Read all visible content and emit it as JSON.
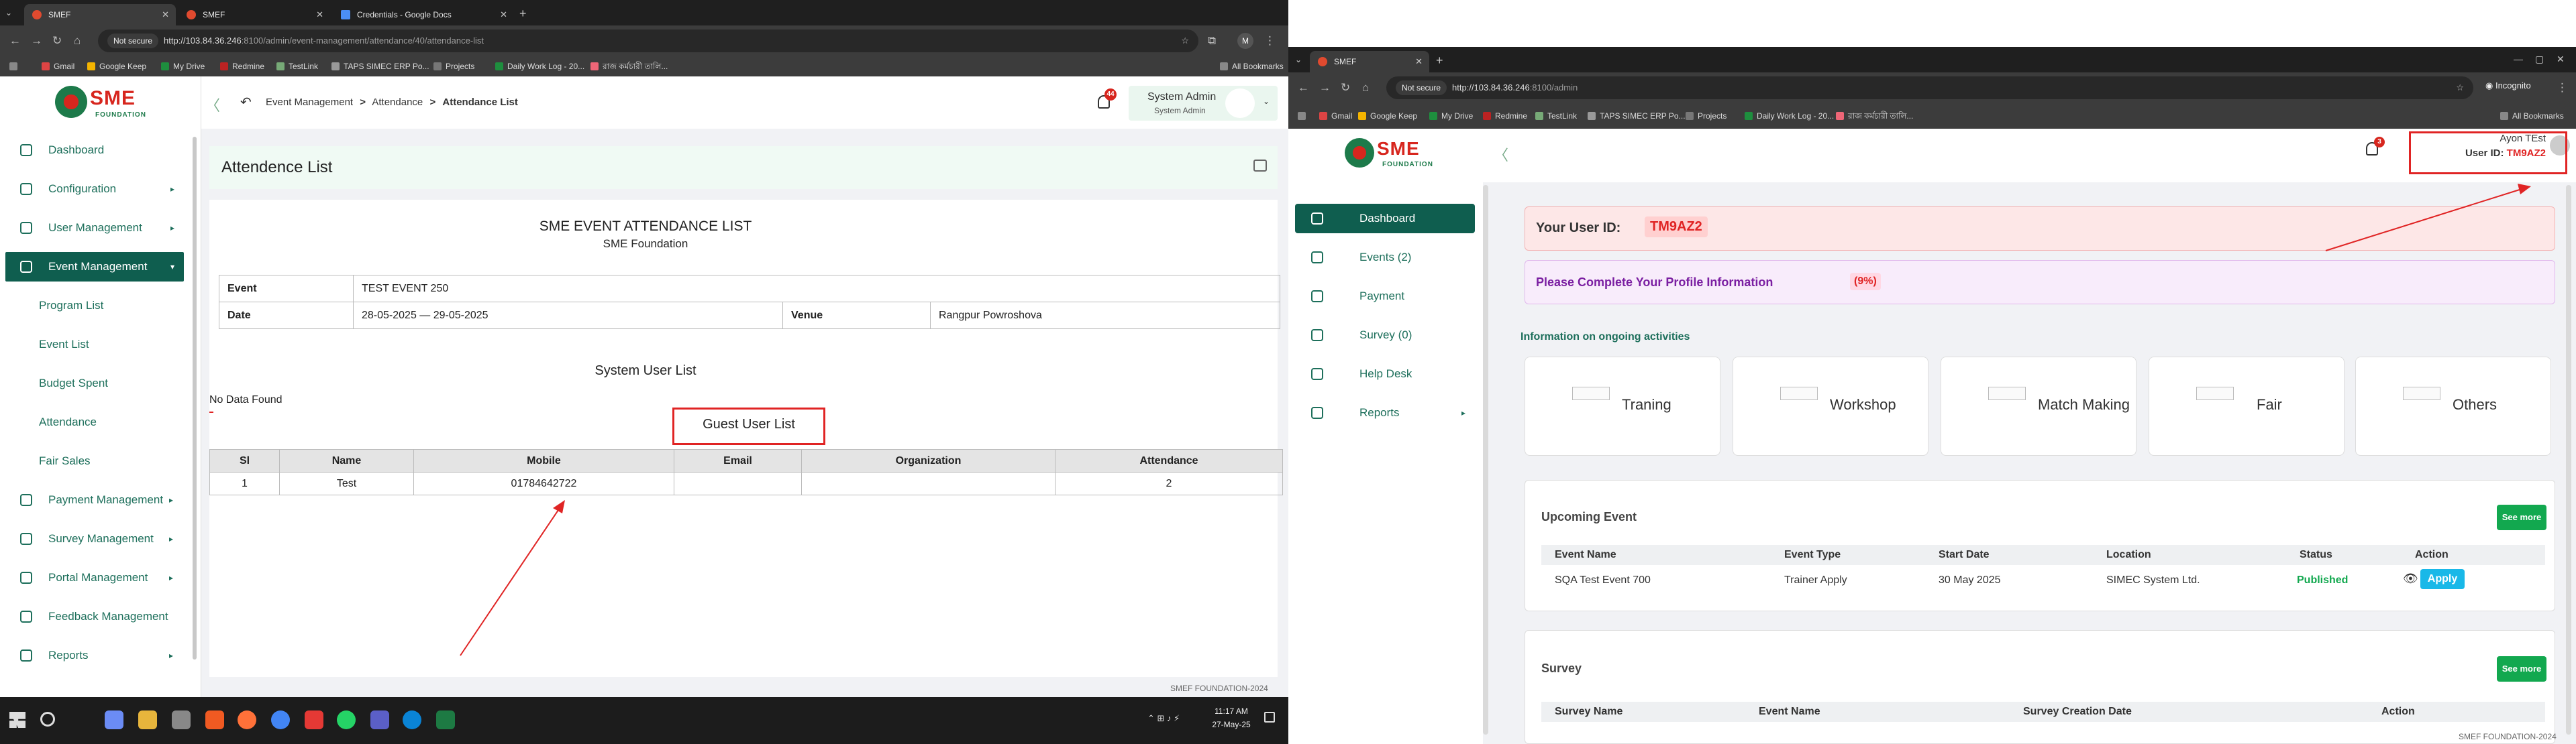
{
  "left": {
    "tabs": [
      {
        "title": "SMEF",
        "active": true
      },
      {
        "title": "SMEF",
        "active": false
      },
      {
        "title": "Credentials - Google Docs",
        "active": false
      }
    ],
    "address": {
      "not_secure": "Not secure",
      "host": "http://103.84.36.246",
      "path": ":8100/admin/event-management/attendance/40/attendance-list"
    },
    "bookmarks": [
      "Gmail",
      "Google Keep",
      "My Drive",
      "Redmine",
      "TestLink",
      "TAPS SIMEC ERP Po...",
      "Projects",
      "Daily Work Log - 20...",
      "রাজ কর্মচারী তালি...",
      "All Bookmarks"
    ],
    "logo": {
      "main": "SME",
      "sub": "FOUNDATION"
    },
    "sidebar": {
      "items": [
        {
          "label": "Dashboard",
          "arrow": ""
        },
        {
          "label": "Configuration",
          "arrow": "▸"
        },
        {
          "label": "User Management",
          "arrow": "▸"
        },
        {
          "label": "Event Management",
          "arrow": "▾"
        }
      ],
      "sub_items": [
        "Program List",
        "Event List",
        "Budget Spent",
        "Attendance",
        "Fair Sales"
      ],
      "items_after": [
        {
          "label": "Payment Management",
          "arrow": "▸"
        },
        {
          "label": "Survey Management",
          "arrow": "▸"
        },
        {
          "label": "Portal Management",
          "arrow": "▸"
        },
        {
          "label": "Feedback Management",
          "arrow": ""
        },
        {
          "label": "Reports",
          "arrow": "▸"
        }
      ]
    },
    "breadcrumb": {
      "part1": "Event Management",
      "part2": "Attendance",
      "current": "Attendance List",
      "sep": ">"
    },
    "notifications": "44",
    "user": {
      "name": "System Admin",
      "role": "System Admin"
    },
    "page_title": "Attendence List",
    "report": {
      "title": "SME EVENT ATTENDANCE LIST",
      "subtitle": "SME Foundation",
      "event_label": "Event",
      "event_value": "TEST EVENT 250",
      "date_label": "Date",
      "date_value": "28-05-2025 — 29-05-2025",
      "venue_label": "Venue",
      "venue_value": "Rangpur Powroshova",
      "system_users_heading": "System User List",
      "no_data": "No Data Found",
      "guest_users_heading": "Guest User List",
      "columns": [
        "Sl",
        "Name",
        "Mobile",
        "Email",
        "Organization",
        "Attendance"
      ],
      "rows": [
        [
          "1",
          "Test",
          "01784642722",
          "",
          "",
          "2"
        ]
      ]
    },
    "footer": "SMEF FOUNDATION-2024",
    "taskbar": {
      "time": "11:17 AM",
      "date": "27-May-25"
    }
  },
  "right": {
    "tabs": [
      {
        "title": "SMEF",
        "active": true
      }
    ],
    "address": {
      "host": "http://103.84.36.246",
      "path": ":8100/admin"
    },
    "incognito": "Incognito",
    "bookmarks": [
      "Gmail",
      "Google Keep",
      "My Drive",
      "Redmine",
      "TestLink",
      "TAPS SIMEC ERP Po...",
      "Projects",
      "Daily Work Log - 20...",
      "রাজ কর্মচারী তালি...",
      "All Bookmarks"
    ],
    "notifications": "3",
    "user": {
      "name": "Ayon TEst",
      "id_label": "User ID:",
      "id_value": "TM9AZ2"
    },
    "sidebar": [
      "Dashboard",
      "Events (2)",
      "Payment",
      "Survey (0)",
      "Help Desk",
      "Reports"
    ],
    "user_id_banner": {
      "label": "Your User ID:",
      "value": "TM9AZ2"
    },
    "profile_banner": {
      "label": "Please Complete Your Profile Information",
      "value": "(9%)"
    },
    "activities_heading": "Information on ongoing activities",
    "activities": [
      "Traning",
      "Workshop",
      "Match Making",
      "Fair",
      "Others"
    ],
    "upcoming": {
      "title": "Upcoming Event",
      "see_more": "See more",
      "columns": [
        "Event Name",
        "Event Type",
        "Start Date",
        "Location",
        "Status",
        "Action"
      ],
      "rows": [
        {
          "name": "SQA Test Event 700",
          "type": "Trainer Apply",
          "start": "30 May 2025",
          "location": "SIMEC System Ltd.",
          "status": "Published",
          "action": "Apply"
        }
      ]
    },
    "survey": {
      "title": "Survey",
      "see_more": "See more",
      "columns": [
        "Survey Name",
        "Event Name",
        "Survey Creation Date",
        "Action"
      ]
    },
    "footer": "SMEF FOUNDATION-2024"
  },
  "colors": {
    "brand_green": "#0f5e4f",
    "accent_red": "#e02424",
    "success": "#12a84f",
    "info": "#19b8e8"
  }
}
